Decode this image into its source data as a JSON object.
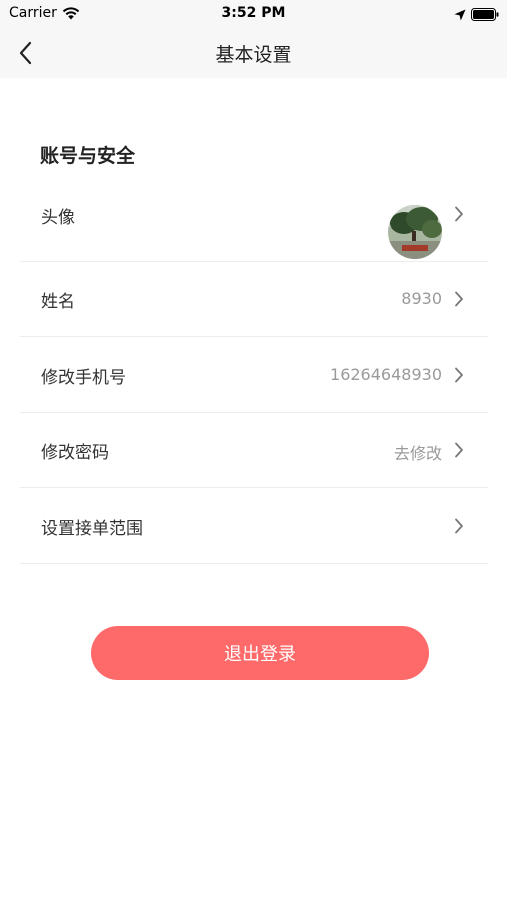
{
  "status_bar": {
    "carrier": "Carrier",
    "time": "3:52 PM",
    "icons": [
      "wifi-icon",
      "location-icon",
      "battery-icon"
    ]
  },
  "nav": {
    "back_icon": "chevron-left-icon",
    "title": "基本设置"
  },
  "section": {
    "title": "账号与安全"
  },
  "rows": [
    {
      "label": "头像",
      "value": "",
      "type": "avatar"
    },
    {
      "label": "姓名",
      "value": "8930"
    },
    {
      "label": "修改手机号",
      "value": "16264648930"
    },
    {
      "label": "修改密码",
      "value": "去修改"
    },
    {
      "label": "设置接单范围",
      "value": ""
    }
  ],
  "logout": {
    "label": "退出登录"
  },
  "colors": {
    "accent": "#fe6a6a",
    "secondary_text": "#9a9a9a",
    "divider": "#ececec",
    "nav_background": "#f7f7f7"
  }
}
